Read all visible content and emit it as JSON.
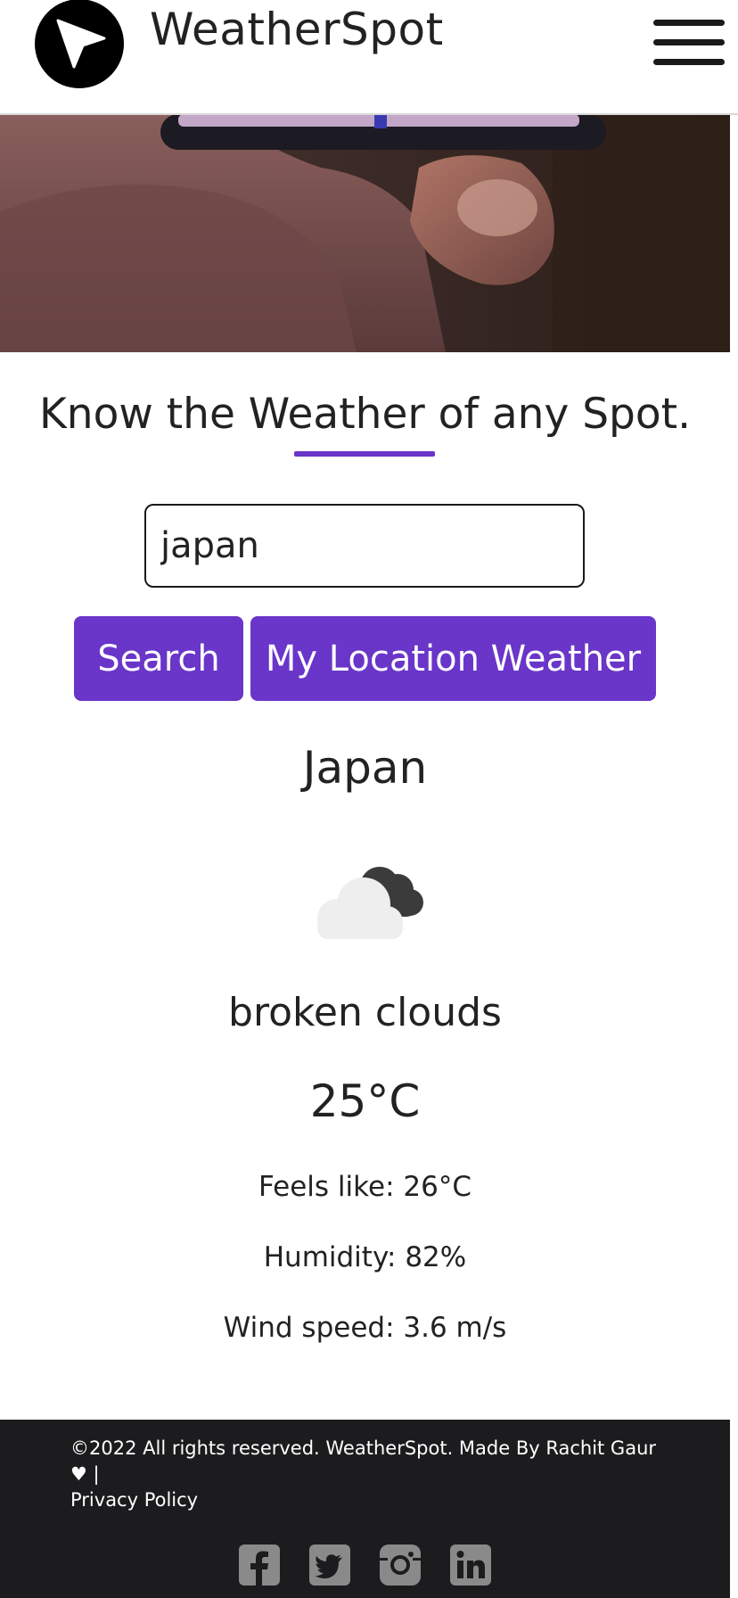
{
  "header": {
    "brand": "WeatherSpot",
    "logo_icon": "navigation-arrow-icon",
    "menu_icon": "hamburger-menu-icon"
  },
  "hero": {
    "image": "hand-holding-phone-photo"
  },
  "main": {
    "headline": "Know the Weather of any Spot.",
    "search": {
      "value": "japan",
      "placeholder": ""
    },
    "search_button": "Search",
    "location_button": "My Location Weather"
  },
  "result": {
    "city": "Japan",
    "icon": "broken-clouds-icon",
    "condition": "broken clouds",
    "temperature": "25°C",
    "feels_like": "Feels like: 26°C",
    "humidity": "Humidity: 82%",
    "wind_speed": "Wind speed: 3.6 m/s"
  },
  "footer": {
    "copyright": "©2022 All rights reserved. WeatherSpot. Made By Rachit Gaur ♥ |",
    "privacy_link": "Privacy Policy",
    "socials": [
      "facebook-icon",
      "twitter-icon",
      "instagram-icon",
      "linkedin-icon"
    ]
  },
  "colors": {
    "accent": "#6a35c9",
    "footer_bg": "#1c1c1e",
    "text": "#222222"
  }
}
